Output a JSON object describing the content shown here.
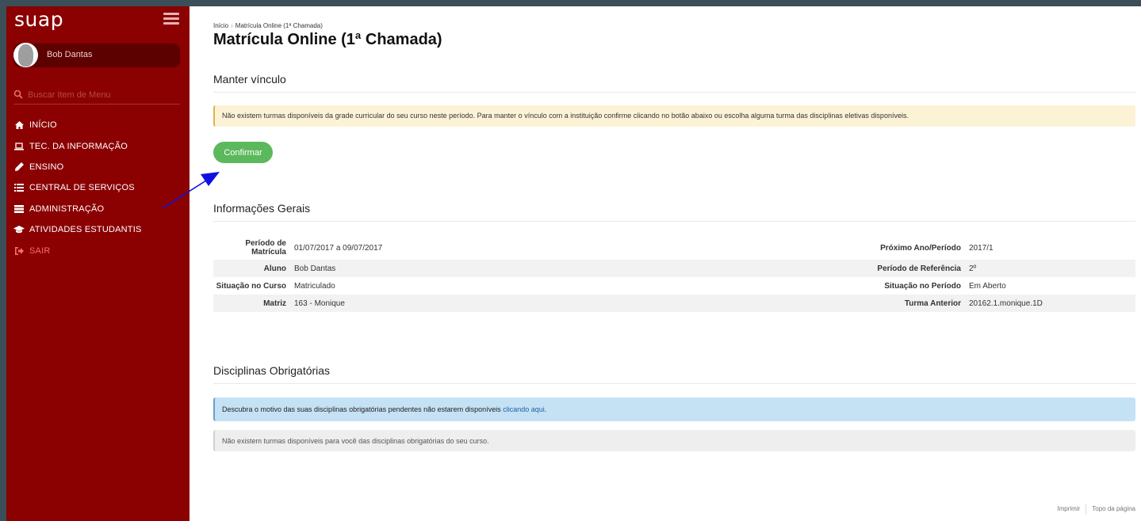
{
  "sidebar": {
    "logo": "suap",
    "user_name": "Bob Dantas",
    "search_placeholder": "Buscar Item de Menu",
    "items": [
      {
        "label": "INÍCIO",
        "icon": "home-icon"
      },
      {
        "label": "TEC. DA INFORMAÇÃO",
        "icon": "laptop-icon"
      },
      {
        "label": "ENSINO",
        "icon": "pencil-icon"
      },
      {
        "label": "CENTRAL DE SERVIÇOS",
        "icon": "list-icon"
      },
      {
        "label": "ADMINISTRAÇÃO",
        "icon": "server-icon"
      },
      {
        "label": "ATIVIDADES ESTUDANTIS",
        "icon": "graduation-cap-icon"
      },
      {
        "label": "SAIR",
        "icon": "sign-out-icon"
      }
    ]
  },
  "breadcrumb": {
    "home": "Início",
    "current": "Matrícula Online (1ª Chamada)"
  },
  "page": {
    "title": "Matrícula Online (1ª Chamada)"
  },
  "manter_vinculo": {
    "title": "Manter vínculo",
    "alert": "Não existem turmas disponíveis da grade curricular do seu curso neste período. Para manter o vínculo com a instituição confirme clicando no botão abaixo ou escolha alguma turma das disciplinas eletivas disponíveis.",
    "button_label": "Confirmar"
  },
  "informacoes_gerais": {
    "title": "Informações Gerais",
    "rows": [
      {
        "l1": "Período de Matrícula",
        "v1": "01/07/2017 a 09/07/2017",
        "l2": "Próximo Ano/Período",
        "v2": "2017/1"
      },
      {
        "l1": "Aluno",
        "v1": "Bob Dantas",
        "l2": "Período de Referência",
        "v2": "2º"
      },
      {
        "l1": "Situação no Curso",
        "v1": "Matriculado",
        "l2": "Situação no Período",
        "v2": "Em Aberto"
      },
      {
        "l1": "Matriz",
        "v1": "163 - Monique",
        "l2": "Turma Anterior",
        "v2": "20162.1.monique.1D"
      }
    ]
  },
  "disciplinas": {
    "title": "Disciplinas Obrigatórias",
    "info_text": "Descubra o motivo das suas disciplinas obrigatórias pendentes não estarem disponíveis",
    "info_link": "clicando aqui",
    "info_end": ".",
    "empty_text": "Não existem turmas disponíveis para você das disciplinas obrigatórias do seu curso."
  },
  "footer": {
    "print": "Imprimir",
    "top": "Topo da página"
  },
  "colors": {
    "sidebar": "#8b0000",
    "confirm_button": "#5cb85c",
    "arrow": "#1010e0"
  }
}
